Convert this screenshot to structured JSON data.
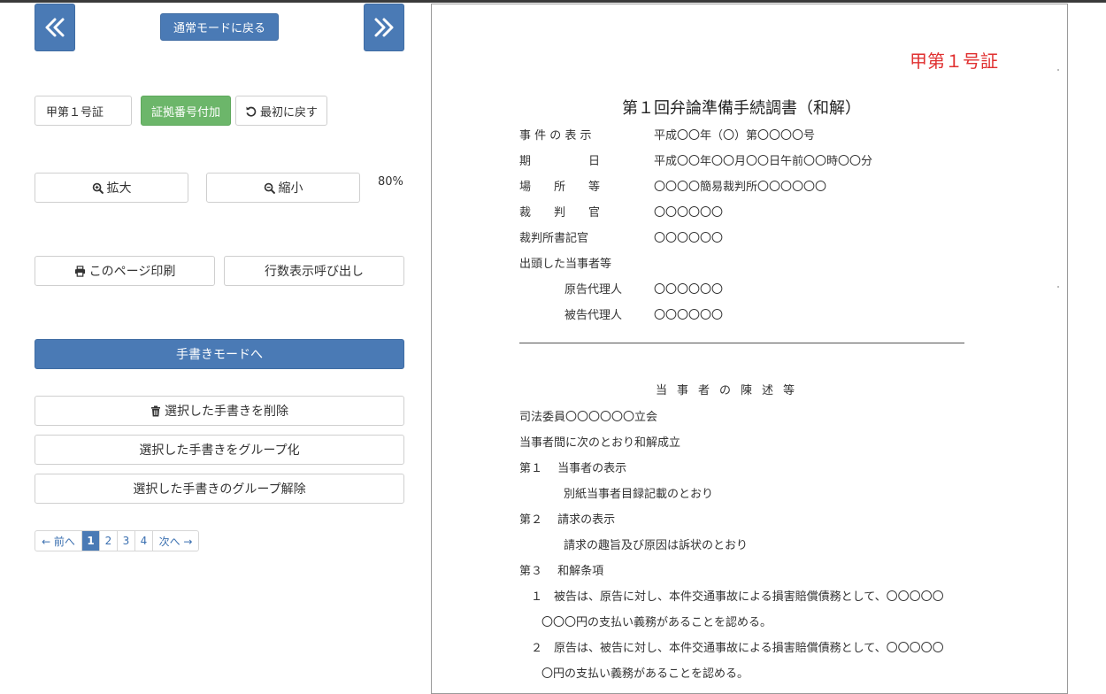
{
  "toolbar": {
    "prev_icon": "double-chevron-left-icon",
    "next_icon": "double-chevron-right-icon",
    "normal_mode_label": "通常モードに戻る",
    "exhibit_value": "甲第１号証",
    "attach_number_label": "証拠番号付加",
    "reset_label": "最初に戻す",
    "zoom_in_label": "拡大",
    "zoom_out_label": "縮小",
    "zoom_level": "80%",
    "print_label": "このページ印刷",
    "line_numbers_label": "行数表示呼び出し",
    "handwrite_mode_label": "手書きモードへ",
    "delete_label": "選択した手書きを削除",
    "group_label": "選択した手書きをグループ化",
    "ungroup_label": "選択した手書きのグループ解除"
  },
  "pagination": {
    "prev": "← 前へ",
    "pages": [
      "1",
      "2",
      "3",
      "4"
    ],
    "current": "1",
    "next": "次へ →"
  },
  "document": {
    "stamp": "甲第１号証",
    "title": "第１回弁論準備手続調書（和解）",
    "header_rows": [
      {
        "label": "事 件 の 表 示",
        "value": "平成〇〇年（〇）第〇〇〇〇号"
      },
      {
        "label": "期　　　　　日",
        "value": "平成〇〇年〇〇月〇〇日午前〇〇時〇〇分"
      },
      {
        "label": "場　　所　　等",
        "value": "〇〇〇〇簡易裁判所〇〇〇〇〇〇"
      },
      {
        "label": "裁　　判　　官",
        "value": "〇〇〇〇〇〇"
      },
      {
        "label": "裁判所書記官",
        "value": "〇〇〇〇〇〇"
      },
      {
        "label": "出頭した当事者等",
        "value": ""
      },
      {
        "label": "原告代理人",
        "value": "〇〇〇〇〇〇"
      },
      {
        "label": "被告代理人",
        "value": "〇〇〇〇〇〇"
      }
    ],
    "section_title": "当事者の陳述等",
    "body": [
      "司法委員〇〇〇〇〇〇立会",
      "当事者間に次のとおり和解成立",
      "第１　 当事者の表示",
      "別紙当事者目録記載のとおり",
      "第２　 請求の表示",
      "請求の趣旨及び原因は訴状のとおり",
      "第３　 和解条項",
      "１　被告は、原告に対し、本件交通事故による損害賠償債務として、〇〇〇〇〇",
      "〇〇〇円の支払い義務があることを認める。",
      "２　原告は、被告に対し、本件交通事故による損害賠償債務として、〇〇〇〇〇",
      "〇円の支払い義務があることを認める。"
    ]
  }
}
